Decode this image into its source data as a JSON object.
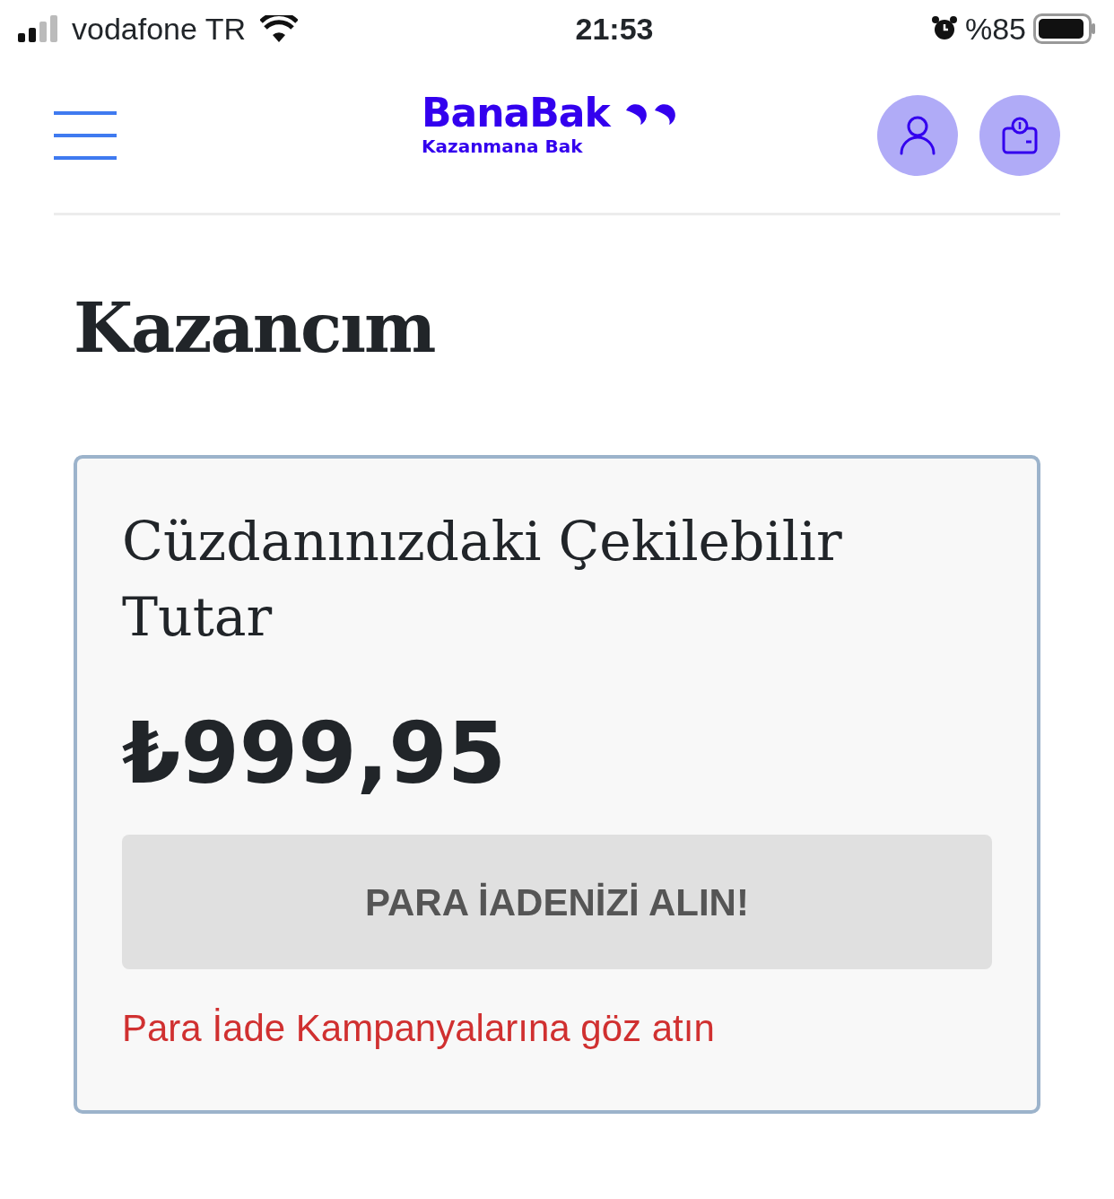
{
  "status_bar": {
    "carrier": "vodafone TR",
    "time": "21:53",
    "battery": "%85"
  },
  "header": {
    "logo": "BanaBak",
    "tagline": "Kazanmana Bak"
  },
  "page_title": "Kazancım",
  "wallet_card": {
    "title": "Cüzdanınızdaki Çekilebilir Tutar",
    "amount": "₺999,95",
    "button": {
      "label": "PARA İADENİZİ ALIN!",
      "disabled": true
    },
    "link": "Para İade Kampanyalarına göz atın"
  }
}
